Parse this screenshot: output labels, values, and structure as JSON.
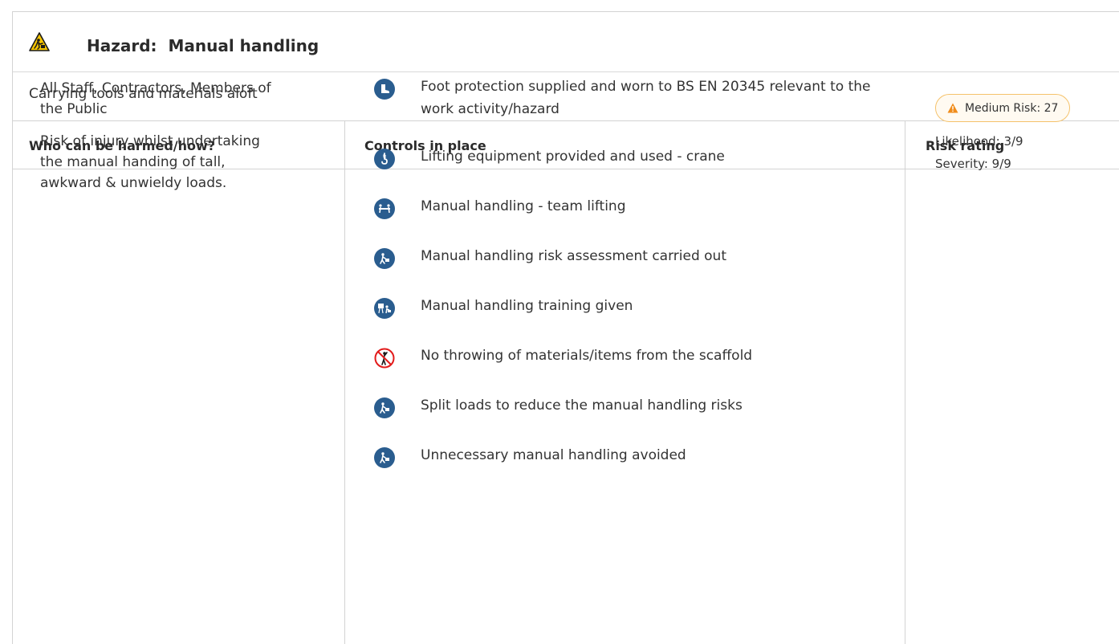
{
  "hazard": {
    "label": "Hazard:",
    "name": "Manual handling",
    "title": "Hazard:  Manual handling",
    "icon": "manual-handling-warning-icon",
    "description": "Carrying tools and materials aloft"
  },
  "columns": {
    "who": "Who can be harmed/how?",
    "controls": "Controls in place",
    "risk": "Risk rating"
  },
  "who": {
    "people": "All Staff, Contractors, Members of the Public",
    "how": "Risk of injury whilst undertaking the manual handing of tall, awkward & unwieldy loads."
  },
  "controls": [
    {
      "text": "Foot protection supplied and worn to BS EN 20345 relevant to the work activity/hazard",
      "icon": "safety-boot-icon"
    },
    {
      "text": "Lifting equipment provided and used - crane",
      "icon": "crane-hook-icon"
    },
    {
      "text": "Manual handling - team lifting",
      "icon": "team-lifting-icon"
    },
    {
      "text": "Manual handling risk assessment carried out",
      "icon": "manual-handling-icon"
    },
    {
      "text": "Manual handling training given",
      "icon": "training-icon"
    },
    {
      "text": "No throwing of materials/items from the scaffold",
      "icon": "no-throwing-icon"
    },
    {
      "text": "Split loads to reduce the manual handling risks",
      "icon": "manual-handling-icon"
    },
    {
      "text": "Unnecessary manual handling avoided",
      "icon": "manual-handling-icon"
    }
  ],
  "risk": {
    "badge": "Medium Risk: 27",
    "likelihood": "Likelihood: 3/9",
    "severity": "Severity: 9/9",
    "badge_icon": "warning-icon"
  },
  "colors": {
    "icon_blue": "#2a5d8f",
    "warning_orange": "#f08c1a",
    "badge_border": "#f5c26b",
    "no_red": "#e21b1b"
  }
}
